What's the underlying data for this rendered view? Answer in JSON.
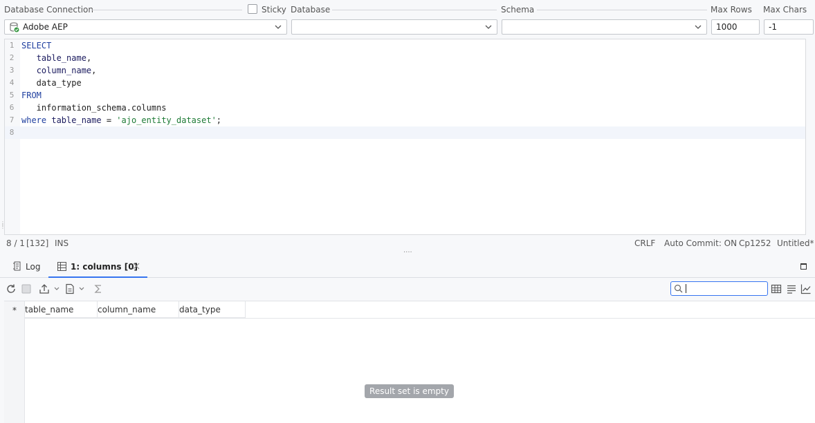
{
  "connection_bar": {
    "database_connection_label": "Database Connection",
    "sticky_label": "Sticky",
    "database_label": "Database",
    "schema_label": "Schema",
    "max_rows_label": "Max Rows",
    "max_chars_label": "Max Chars",
    "connection_value": "Adobe AEP",
    "database_value": "",
    "schema_value": "",
    "max_rows_value": "1000",
    "max_chars_value": "-1",
    "sticky_checked": false
  },
  "editor": {
    "lines": [
      {
        "num": "1",
        "parts": [
          {
            "t": "SELECT",
            "c": "kw"
          }
        ]
      },
      {
        "num": "2",
        "parts": [
          {
            "t": "   ",
            "c": "plain"
          },
          {
            "t": "table_name",
            "c": "id"
          },
          {
            "t": ",",
            "c": "plain"
          }
        ]
      },
      {
        "num": "3",
        "parts": [
          {
            "t": "   ",
            "c": "plain"
          },
          {
            "t": "column_name",
            "c": "id"
          },
          {
            "t": ",",
            "c": "plain"
          }
        ]
      },
      {
        "num": "4",
        "parts": [
          {
            "t": "   data_type",
            "c": "plain"
          }
        ]
      },
      {
        "num": "5",
        "parts": [
          {
            "t": "FROM",
            "c": "kw"
          }
        ]
      },
      {
        "num": "6",
        "parts": [
          {
            "t": "   information_schema.columns",
            "c": "plain"
          }
        ]
      },
      {
        "num": "7",
        "parts": [
          {
            "t": "where",
            "c": "kw"
          },
          {
            "t": " ",
            "c": "plain"
          },
          {
            "t": "table_name",
            "c": "id"
          },
          {
            "t": " = ",
            "c": "plain"
          },
          {
            "t": "'ajo_entity_dataset'",
            "c": "str"
          },
          {
            "t": ";",
            "c": "plain"
          }
        ]
      },
      {
        "num": "8",
        "parts": []
      }
    ]
  },
  "status_bar": {
    "position": "8 / 1",
    "offset": "[132]",
    "mode": "INS",
    "line_ending": "CRLF",
    "auto_commit": "Auto Commit: ON",
    "encoding": "Cp1252",
    "file": "Untitled*",
    "splitter": "...."
  },
  "result_tabs": {
    "log_label": "Log",
    "result_label": "1: columns [0]"
  },
  "result_grid": {
    "star": "*",
    "columns": [
      "table_name",
      "column_name",
      "data_type"
    ],
    "rows": [],
    "empty_message": "Result set is empty"
  },
  "colors": {
    "accent": "#3574f0",
    "keyword": "#1f3f9f",
    "string": "#1d7a35"
  }
}
